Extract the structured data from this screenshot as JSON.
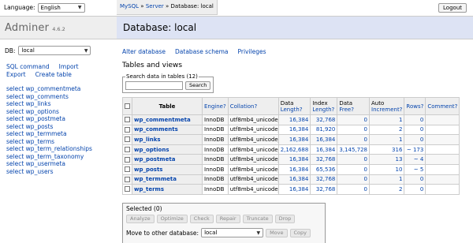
{
  "sidebar": {
    "language_label": "Language:",
    "language_value": "English",
    "app_name": "Adminer",
    "version": "4.6.2",
    "db_label": "DB:",
    "db_value": "local",
    "links": {
      "sql_command": "SQL command",
      "import": "Import",
      "export": "Export",
      "create_table": "Create table"
    },
    "tables": [
      "select wp_commentmeta",
      "select wp_comments",
      "select wp_links",
      "select wp_options",
      "select wp_postmeta",
      "select wp_posts",
      "select wp_termmeta",
      "select wp_terms",
      "select wp_term_relationships",
      "select wp_term_taxonomy",
      "select wp_usermeta",
      "select wp_users"
    ]
  },
  "header": {
    "crumb_mysql": "MySQL",
    "crumb_sep1": "»",
    "crumb_server": "Server",
    "crumb_sep2": "»",
    "crumb_current": "Database: local",
    "logout": "Logout",
    "title": "Database: local"
  },
  "main": {
    "nav": {
      "alter_database": "Alter database",
      "database_schema": "Database schema",
      "privileges": "Privileges"
    },
    "section_title": "Tables and views",
    "search": {
      "legend": "Search data in tables (12)",
      "button": "Search"
    },
    "columns": {
      "table": "Table",
      "engine": "Engine?",
      "collation": "Collation?",
      "data_length_1": "Data",
      "data_length_2": "Length?",
      "index_length_1": "Index",
      "index_length_2": "Length?",
      "data_free_1": "Data",
      "data_free_2": "Free?",
      "auto_inc_1": "Auto",
      "auto_inc_2": "Increment?",
      "rows": "Rows?",
      "comment": "Comment?"
    },
    "rows": [
      {
        "name": "wp_commentmeta",
        "engine": "InnoDB",
        "collation": "utf8mb4_unicode_520_ci",
        "data_length": "16,384",
        "index_length": "32,768",
        "data_free": "0",
        "auto_increment": "1",
        "rows": "0"
      },
      {
        "name": "wp_comments",
        "engine": "InnoDB",
        "collation": "utf8mb4_unicode_520_ci",
        "data_length": "16,384",
        "index_length": "81,920",
        "data_free": "0",
        "auto_increment": "2",
        "rows": "0"
      },
      {
        "name": "wp_links",
        "engine": "InnoDB",
        "collation": "utf8mb4_unicode_520_ci",
        "data_length": "16,384",
        "index_length": "16,384",
        "data_free": "0",
        "auto_increment": "1",
        "rows": "0"
      },
      {
        "name": "wp_options",
        "engine": "InnoDB",
        "collation": "utf8mb4_unicode_520_ci",
        "data_length": "2,162,688",
        "index_length": "16,384",
        "data_free": "3,145,728",
        "auto_increment": "316",
        "rows": "~ 173"
      },
      {
        "name": "wp_postmeta",
        "engine": "InnoDB",
        "collation": "utf8mb4_unicode_520_ci",
        "data_length": "16,384",
        "index_length": "32,768",
        "data_free": "0",
        "auto_increment": "13",
        "rows": "~ 4"
      },
      {
        "name": "wp_posts",
        "engine": "InnoDB",
        "collation": "utf8mb4_unicode_520_ci",
        "data_length": "16,384",
        "index_length": "65,536",
        "data_free": "0",
        "auto_increment": "10",
        "rows": "~ 5"
      },
      {
        "name": "wp_termmeta",
        "engine": "InnoDB",
        "collation": "utf8mb4_unicode_520_ci",
        "data_length": "16,384",
        "index_length": "32,768",
        "data_free": "0",
        "auto_increment": "1",
        "rows": "0"
      },
      {
        "name": "wp_terms",
        "engine": "InnoDB",
        "collation": "utf8mb4_unicode_520_ci",
        "data_length": "16,384",
        "index_length": "32,768",
        "data_free": "0",
        "auto_increment": "2",
        "rows": "0"
      }
    ],
    "selected": {
      "legend": "Selected (0)",
      "analyze": "Analyze",
      "optimize": "Optimize",
      "check": "Check",
      "repair": "Repair",
      "truncate": "Truncate",
      "drop": "Drop",
      "move_label": "Move to other database:",
      "move_db": "local",
      "move_button": "Move",
      "copy_button": "Copy"
    }
  }
}
